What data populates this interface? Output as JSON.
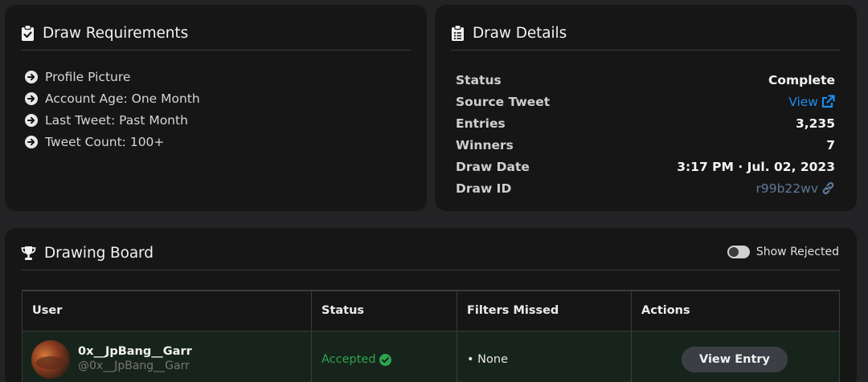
{
  "requirements": {
    "title": "Draw Requirements",
    "icon": "clipboard-check-icon",
    "items": [
      {
        "label": "Profile Picture"
      },
      {
        "label": "Account Age: One Month"
      },
      {
        "label": "Last Tweet: Past Month"
      },
      {
        "label": "Tweet Count: 100+"
      }
    ]
  },
  "details": {
    "title": "Draw Details",
    "icon": "clipboard-list-icon",
    "rows": [
      {
        "label": "Status",
        "value": "Complete"
      },
      {
        "label": "Source Tweet",
        "value": "View"
      },
      {
        "label": "Entries",
        "value": "3,235"
      },
      {
        "label": "Winners",
        "value": "7"
      },
      {
        "label": "Draw Date",
        "value": "3:17 PM · Jul. 02, 2023"
      },
      {
        "label": "Draw ID",
        "value": "r99b22wv"
      }
    ]
  },
  "board": {
    "title": "Drawing Board",
    "icon": "trophy-icon",
    "toggle_label": "Show Rejected",
    "toggle_on": false,
    "columns": [
      "User",
      "Status",
      "Filters Missed",
      "Actions"
    ],
    "rows": [
      {
        "name": "0x__JpBang__Garr",
        "handle": "@0x__JpBang__Garr",
        "status": "Accepted",
        "filters": "• None",
        "action": "View Entry"
      }
    ]
  },
  "colors": {
    "background": "#232325",
    "card": "#161616",
    "link": "#1d8cf0",
    "accepted": "#2ea44f",
    "draw_id": "#5f7a98"
  }
}
